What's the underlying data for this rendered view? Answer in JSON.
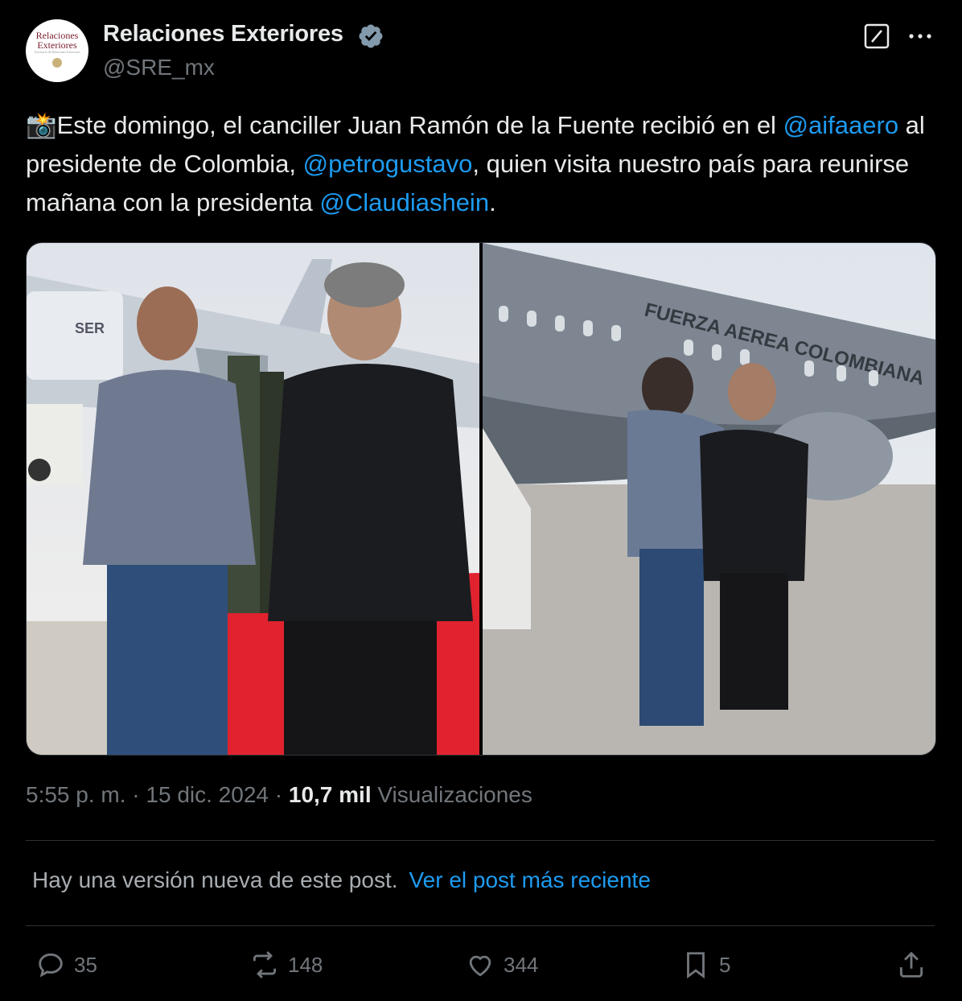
{
  "author": {
    "avatar_text": [
      "Relaciones",
      "Exteriores",
      "Secretaría de Relaciones Exteriores"
    ],
    "name": "Relaciones Exteriores",
    "handle": "@SRE_mx"
  },
  "post": {
    "emoji": "📸",
    "text_segments": [
      {
        "text": "Este domingo, el canciller Juan Ramón de la Fuente recibió en el ",
        "type": "text"
      },
      {
        "text": "@aifaaero",
        "type": "mention"
      },
      {
        "text": " al presidente de Colombia, ",
        "type": "text"
      },
      {
        "text": "@petrogustavo",
        "type": "mention"
      },
      {
        "text": ", quien visita nuestro país para reunirse mañana con la presidenta ",
        "type": "text"
      },
      {
        "text": "@Claudiashein",
        "type": "mention"
      },
      {
        "text": ".",
        "type": "text"
      }
    ],
    "photo_left_text": "SER",
    "photo_right_text": "FUERZA AEREA COLOMBIANA"
  },
  "meta": {
    "time": "5:55 p. m.",
    "sep": "·",
    "date": "15 dic. 2024",
    "views_count": "10,7 mil",
    "views_label": "Visualizaciones"
  },
  "notice": {
    "text": "Hay una versión nueva de este post.",
    "link": "Ver el post más reciente"
  },
  "actions": {
    "replies": "35",
    "reposts": "148",
    "likes": "344",
    "bookmarks": "5"
  },
  "colors": {
    "background": "#000000",
    "text": "#e7e9ea",
    "secondary": "#71767b",
    "link": "#1d9bf0",
    "divider": "#2f3336",
    "red_carpet": "#e0232e"
  },
  "icons": [
    "verified-badge-icon",
    "grok-icon",
    "more-icon",
    "reply-icon",
    "repost-icon",
    "like-icon",
    "bookmark-icon",
    "share-icon"
  ]
}
